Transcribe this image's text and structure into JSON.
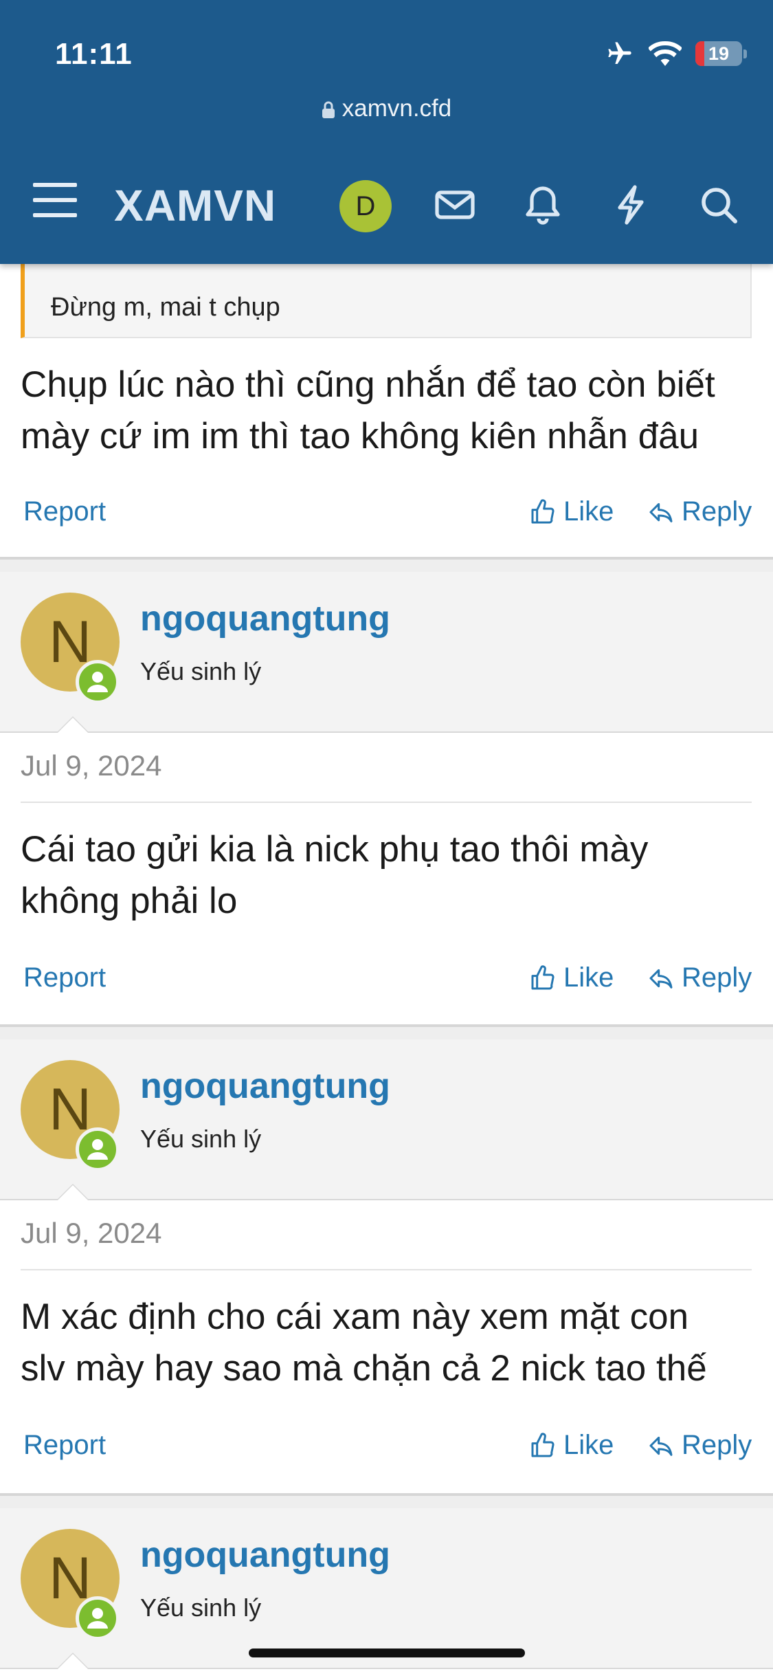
{
  "status_bar": {
    "time": "11:11",
    "battery_level": "19",
    "battery_fraction": 0.19
  },
  "browser": {
    "url": "xamvn.cfd"
  },
  "nav": {
    "logo": "XAMVN",
    "user_initial": "D"
  },
  "quote": {
    "text": "Đừng m, mai t chụp"
  },
  "posts": [
    {
      "text_lines": [
        "Chụp lúc nào thì cũng nhắn để tao còn biết",
        "mày cứ im im thì tao không kiên nhẫn đâu"
      ],
      "report": "Report",
      "like": "Like",
      "reply": "Reply"
    },
    {
      "author": "ngoquangtung",
      "author_initial": "N",
      "author_title": "Yếu sinh lý",
      "date": "Jul 9, 2024",
      "text_lines": [
        "Cái tao gửi kia là nick phụ tao thôi mày",
        "không phải lo"
      ],
      "report": "Report",
      "like": "Like",
      "reply": "Reply"
    },
    {
      "author": "ngoquangtung",
      "author_initial": "N",
      "author_title": "Yếu sinh lý",
      "date": "Jul 9, 2024",
      "text_lines": [
        "M xác định cho cái xam này xem mặt con",
        "slv mày hay sao mà chặn cả 2 nick tao thế"
      ],
      "report": "Report",
      "like": "Like",
      "reply": "Reply"
    },
    {
      "author": "ngoquangtung",
      "author_initial": "N",
      "author_title": "Yếu sinh lý"
    }
  ],
  "colors": {
    "header_bg": "#1d5a8c",
    "link": "#2577b1",
    "quote_accent": "#f0a01c",
    "online": "#7cbd2f"
  }
}
